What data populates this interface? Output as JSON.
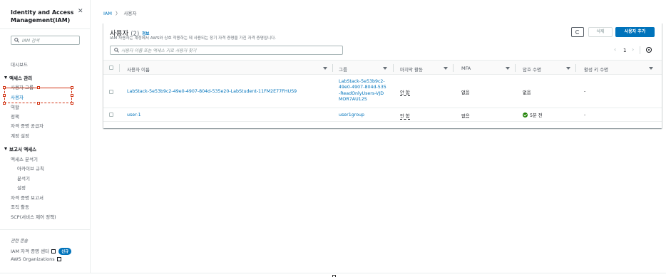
{
  "sidebar": {
    "title": "Identity and Access Management(IAM)",
    "search_placeholder": "IAM 검색",
    "dashboard": "대시보드",
    "access_mgmt": {
      "heading": "액세스 관리",
      "items": [
        "사용자 그룹",
        "사용자",
        "역할",
        "정책",
        "자격 증명 공급자",
        "계정 설정"
      ]
    },
    "reports": {
      "heading": "보고서 액세스",
      "items": [
        "액세스 분석기",
        "아카이브 규칙",
        "분석기",
        "설정",
        "자격 증명 보고서",
        "조직 활동",
        "SCP(서비스 제어 정책)"
      ]
    },
    "related": {
      "heading": "관련 콘솔",
      "items": [
        "IAM 자격 증명 센터",
        "AWS Organizations"
      ],
      "new_badge": "신규"
    }
  },
  "breadcrumb": {
    "root": "IAM",
    "current": "사용자"
  },
  "panel": {
    "title": "사용자",
    "count": "(2)",
    "info": "정보",
    "description": "IAM 사용자는 계정에서 AWS와 상호 작용하는 데 사용되는 장기 자격 증명을 가진 자격 증명입니다.",
    "delete_label": "삭제",
    "add_label": "사용자 추가",
    "search_placeholder": "사용자 이름 또는 액세스 키로 사용자 찾기",
    "page": "1",
    "prev": "‹",
    "next": "›"
  },
  "table": {
    "columns": [
      "사용자 이름",
      "그룹",
      "마지막 활동",
      "MFA",
      "암호 수명",
      "활성 키 수명"
    ],
    "rows": [
      {
        "name": "LabStack-5e53b9c2-49e0-4907-804d-535e20-LabStudent-11FM2E77FHUS9",
        "group": "LabStack-5e53b9c2-49e0-4907-804d-535-ReadOnlyUsers-VJDMOR7AU12S",
        "last_activity": "안 함",
        "mfa": "없음",
        "password_age": "없음",
        "key_age": "-"
      },
      {
        "name": "user-1",
        "group": "user1group",
        "last_activity": "안 함",
        "mfa": "없음",
        "password_age": "5분 전",
        "key_age": "-"
      }
    ]
  },
  "icons": {
    "search": "search-icon",
    "close": "close-icon",
    "refresh": "refresh-icon",
    "settings": "gear-icon",
    "external": "external-link-icon",
    "success": "check-circle-icon"
  },
  "colors": {
    "link": "#0073bb",
    "primary": "#0073bb",
    "success": "#1d8102",
    "selection": "#d13212"
  }
}
